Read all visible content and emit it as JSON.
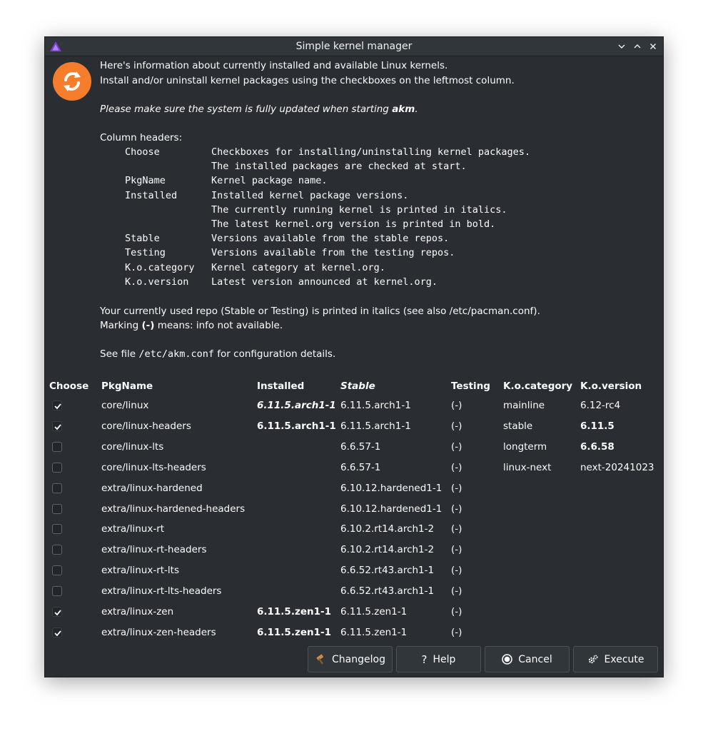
{
  "window": {
    "title": "Simple kernel manager"
  },
  "intro": {
    "line1": "Here's information about currently installed and available Linux kernels.",
    "line2": "Install and/or uninstall kernel packages using the checkboxes on the leftmost column.",
    "update_note_prefix": "Please make sure the system is fully updated when starting ",
    "update_note_app": "akm",
    "update_note_suffix": ".",
    "column_headers_title": "Column headers:",
    "column_docs": [
      {
        "name": "Choose",
        "desc": "Checkboxes for installing/uninstalling kernel packages."
      },
      {
        "name": "",
        "desc": "The installed packages are checked at start."
      },
      {
        "name": "PkgName",
        "desc": "Kernel package name."
      },
      {
        "name": "Installed",
        "desc": "Installed kernel package versions."
      },
      {
        "name": "",
        "desc": "The currently running kernel is printed in italics."
      },
      {
        "name": "",
        "desc": "The latest kernel.org version is printed in bold."
      },
      {
        "name": "Stable",
        "desc": "Versions available from the stable repos."
      },
      {
        "name": "Testing",
        "desc": "Versions available from the testing repos."
      },
      {
        "name": "K.o.category",
        "desc": "Kernel category at kernel.org."
      },
      {
        "name": "K.o.version",
        "desc": "Latest version announced at kernel.org."
      }
    ],
    "repo_note": "Your currently used repo (Stable or Testing) is printed in italics (see also /etc/pacman.conf).",
    "marking_prefix": "Marking ",
    "marking_symbol": "(-)",
    "marking_suffix": " means: info not available.",
    "see_prefix": "See file ",
    "see_path": "/etc/akm.conf",
    "see_suffix": " for configuration details."
  },
  "table": {
    "headers": {
      "choose": "Choose",
      "pkgname": "PkgName",
      "installed": "Installed",
      "stable": "Stable",
      "testing": "Testing",
      "category": "K.o.category",
      "version": "K.o.version"
    },
    "rows": [
      {
        "checked": true,
        "pkg": "core/linux",
        "installed": "6.11.5.arch1-1",
        "stable": "6.11.5.arch1-1",
        "testing": "(-)",
        "category": "mainline",
        "version": "6.12-rc4"
      },
      {
        "checked": true,
        "pkg": "core/linux-headers",
        "installed": "6.11.5.arch1-1",
        "stable": "6.11.5.arch1-1",
        "testing": "(-)",
        "category": "stable",
        "version": "6.11.5"
      },
      {
        "checked": false,
        "pkg": "core/linux-lts",
        "installed": "",
        "stable": "6.6.57-1",
        "testing": "(-)",
        "category": "longterm",
        "version": "6.6.58"
      },
      {
        "checked": false,
        "pkg": "core/linux-lts-headers",
        "installed": "",
        "stable": "6.6.57-1",
        "testing": "(-)",
        "category": "linux-next",
        "version": "next-20241023"
      },
      {
        "checked": false,
        "pkg": "extra/linux-hardened",
        "installed": "",
        "stable": "6.10.12.hardened1-1",
        "testing": "(-)",
        "category": "",
        "version": ""
      },
      {
        "checked": false,
        "pkg": "extra/linux-hardened-headers",
        "installed": "",
        "stable": "6.10.12.hardened1-1",
        "testing": "(-)",
        "category": "",
        "version": ""
      },
      {
        "checked": false,
        "pkg": "extra/linux-rt",
        "installed": "",
        "stable": "6.10.2.rt14.arch1-2",
        "testing": "(-)",
        "category": "",
        "version": ""
      },
      {
        "checked": false,
        "pkg": "extra/linux-rt-headers",
        "installed": "",
        "stable": "6.10.2.rt14.arch1-2",
        "testing": "(-)",
        "category": "",
        "version": ""
      },
      {
        "checked": false,
        "pkg": "extra/linux-rt-lts",
        "installed": "",
        "stable": "6.6.52.rt43.arch1-1",
        "testing": "(-)",
        "category": "",
        "version": ""
      },
      {
        "checked": false,
        "pkg": "extra/linux-rt-lts-headers",
        "installed": "",
        "stable": "6.6.52.rt43.arch1-1",
        "testing": "(-)",
        "category": "",
        "version": ""
      },
      {
        "checked": true,
        "pkg": "extra/linux-zen",
        "installed": "6.11.5.zen1-1",
        "stable": "6.11.5.zen1-1",
        "testing": "(-)",
        "category": "",
        "version": ""
      },
      {
        "checked": true,
        "pkg": "extra/linux-zen-headers",
        "installed": "6.11.5.zen1-1",
        "stable": "6.11.5.zen1-1",
        "testing": "(-)",
        "category": "",
        "version": ""
      }
    ]
  },
  "buttons": {
    "changelog": "Changelog",
    "help": "Help",
    "cancel": "Cancel",
    "execute": "Execute"
  },
  "colors": {
    "background": "#2a2e32",
    "titlebar": "#31363b",
    "accent_orange": "#f67d2b",
    "text": "#fcfcfc"
  },
  "icons": {
    "app": "arch-triangle-icon",
    "main": "refresh-icon",
    "changelog": "hammer-icon",
    "help": "question-icon",
    "cancel": "cancel-icon",
    "execute": "gears-icon"
  }
}
